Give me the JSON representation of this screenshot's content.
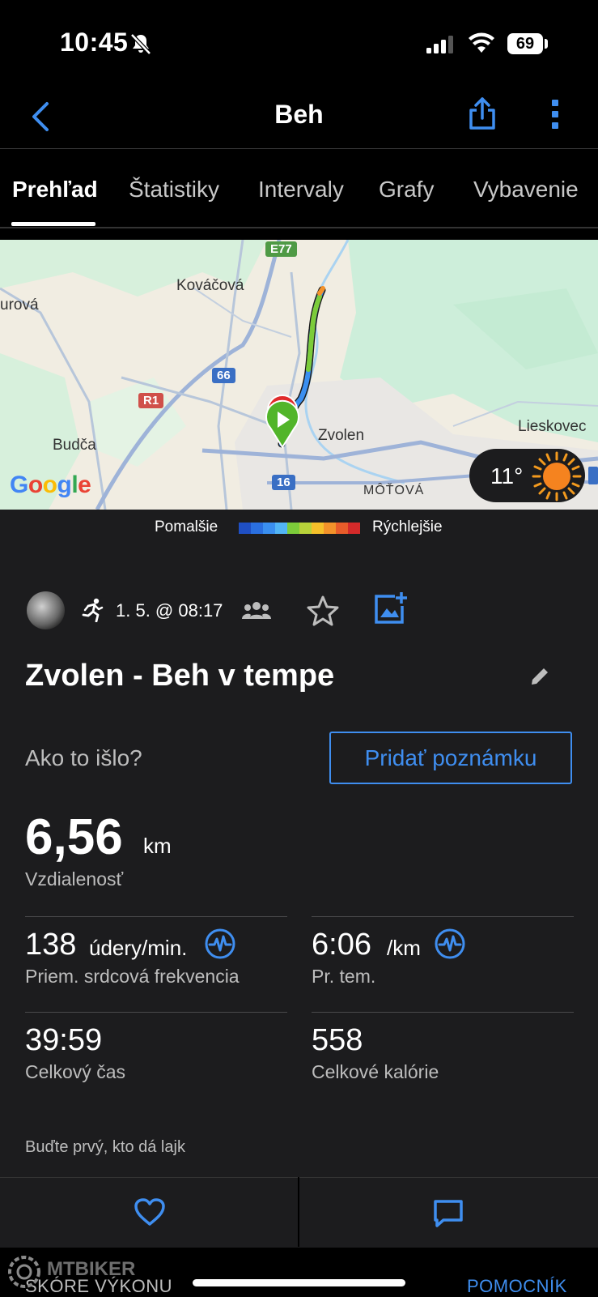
{
  "status_bar": {
    "time": "10:45",
    "battery": "69"
  },
  "header": {
    "title": "Beh"
  },
  "tabs": [
    {
      "label": "Prehľad"
    },
    {
      "label": "Štatistiky"
    },
    {
      "label": "Intervaly"
    },
    {
      "label": "Grafy"
    },
    {
      "label": "Vybavenie"
    }
  ],
  "map": {
    "places": {
      "kovacova": "Kováčová",
      "urova": "urová",
      "budca": "Budča",
      "zvolen": "Zvolen",
      "lieskovec": "Lieskovec",
      "motova": "MÔŤOVÁ"
    },
    "roads": {
      "e77": "E77",
      "r66": "66",
      "r1": "R1",
      "r16": "16"
    },
    "google": [
      "G",
      "o",
      "o",
      "g",
      "l",
      "e"
    ],
    "weather": {
      "temp": "11°",
      "icon": "sun-icon"
    }
  },
  "legend": {
    "slower": "Pomalšie",
    "faster": "Rýchlejšie",
    "colors": [
      "#1f4fc4",
      "#2a6fe0",
      "#3a8ff0",
      "#52b5f5",
      "#7ccc3a",
      "#b8d23a",
      "#f5c02a",
      "#f3922a",
      "#e85c2a",
      "#d42a2a"
    ]
  },
  "activity": {
    "date": "1. 5. @ 08:17",
    "title": "Zvolen - Beh v tempe",
    "prompt": "Ako to išlo?",
    "note_button": "Pridať poznámku"
  },
  "stats": {
    "distance": {
      "value": "6,56",
      "unit": "km",
      "label": "Vzdialenosť"
    },
    "heart_rate": {
      "value": "138",
      "unit": "údery/min.",
      "label": "Priem. srdcová frekvencia"
    },
    "pace": {
      "value": "6:06",
      "unit": "/km",
      "label": "Pr. tem."
    },
    "time": {
      "value": "39:59",
      "label": "Celkový čas"
    },
    "calories": {
      "value": "558",
      "label": "Celkové kalórie"
    }
  },
  "likes": {
    "text": "Buďte prvý, kto dá lajk"
  },
  "bottom": {
    "left": "SKÓRE VÝKONU",
    "right": "POMOCNÍK",
    "watermark": "MTBIKER"
  },
  "colors": {
    "accent": "#3f8ef0",
    "background": "#1c1c1e",
    "map_bg": "#f1ede2",
    "start_marker": "#52b52a",
    "end_marker": "#e02b2b"
  }
}
